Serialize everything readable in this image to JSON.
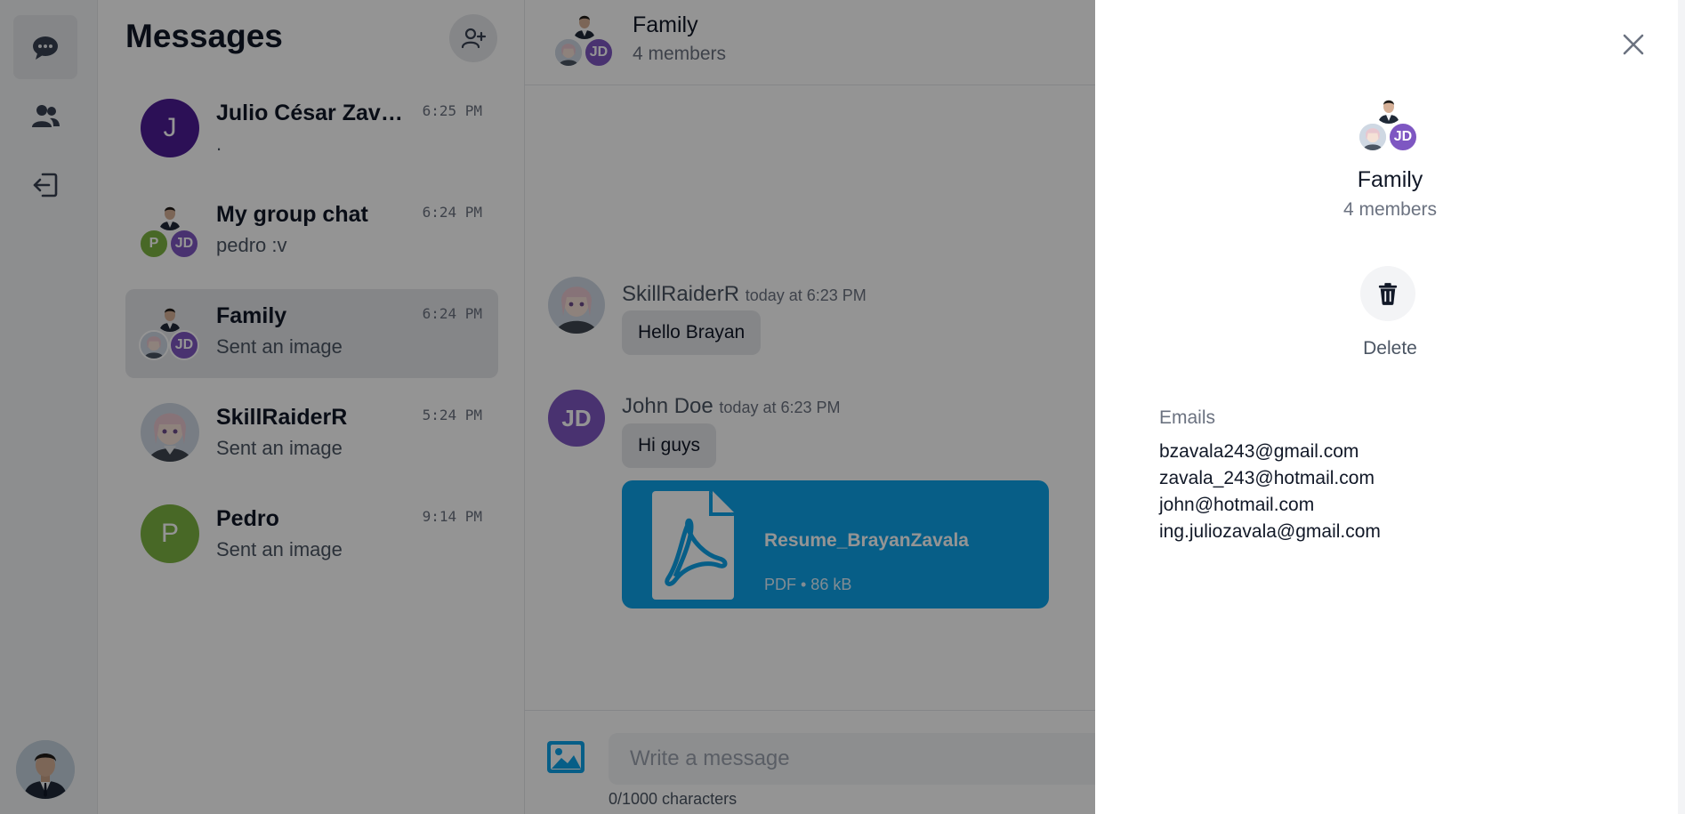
{
  "sidebar": {
    "nav": [
      {
        "icon": "chat-bubbles-icon"
      },
      {
        "icon": "users-icon"
      },
      {
        "icon": "logout-icon"
      }
    ],
    "profile_icon": "user-avatar"
  },
  "conversations": {
    "title": "Messages",
    "new_chat_icon": "add-user-icon",
    "items": [
      {
        "name": "Julio César Zavala",
        "preview": ".",
        "time": "6:25 PM",
        "avatar_letter": "J",
        "avatar_color": "#4c1d95"
      },
      {
        "name": "My group chat",
        "preview": "pedro :v",
        "time": "6:24 PM",
        "mini_letter": "P",
        "mini_color": "#7cb342",
        "mini_initials": "JD"
      },
      {
        "name": "Family",
        "preview": "Sent an image",
        "time": "6:24 PM",
        "mini_initials": "JD"
      },
      {
        "name": "SkillRaiderR",
        "preview": "Sent an image",
        "time": "5:24 PM"
      },
      {
        "name": "Pedro",
        "preview": "Sent an image",
        "time": "9:14 PM",
        "avatar_letter": "P",
        "avatar_color": "#7cb342"
      }
    ]
  },
  "chat": {
    "title": "Family",
    "subtitle": "4 members",
    "header_initials": "JD",
    "messages": [
      {
        "author": "SkillRaiderR",
        "when": "today at 6:23 PM",
        "text": "Hello Brayan"
      },
      {
        "author": "John Doe",
        "avatar_initials": "JD",
        "when": "today at 6:23 PM",
        "text": "Hi guys"
      }
    ],
    "attachment": {
      "name": "Resume_BrayanZavala",
      "meta": "PDF • 86 kB"
    },
    "composer": {
      "placeholder": "Write a message",
      "count": "0/1000 characters"
    }
  },
  "details": {
    "title": "Family",
    "subtitle": "4 members",
    "initials": "JD",
    "delete_label": "Delete",
    "emails_title": "Emails",
    "emails": [
      "bzavala243@gmail.com",
      "zavala_243@hotmail.com",
      "john@hotmail.com",
      "ing.juliozavala@gmail.com"
    ]
  },
  "colors": {
    "accent": "#0da3e8",
    "jd_purple": "#7e57c2",
    "overlay": "rgba(0,0,0,0.42)"
  }
}
